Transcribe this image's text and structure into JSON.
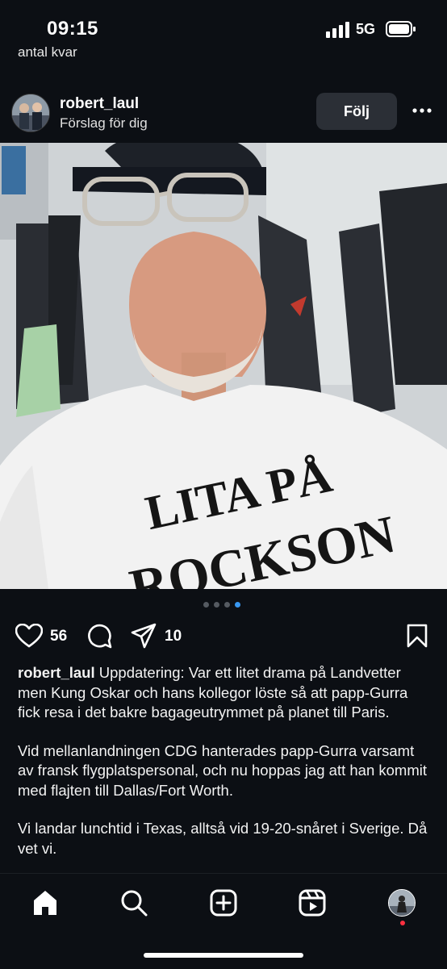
{
  "status": {
    "time": "09:15",
    "network": "5G"
  },
  "prev_caption": "antal kvar",
  "post": {
    "username": "robert_laul",
    "subtitle": "Förslag för dig",
    "follow_label": "Följ",
    "shirt_text_line1": "LITA PÅ",
    "shirt_text_line2": "ROCKSON",
    "carousel": {
      "count": 4,
      "active_index": 3
    },
    "likes": "56",
    "shares": "10",
    "caption_user": "robert_laul",
    "caption_p1": "Uppdatering: Var ett litet drama på Landvetter men Kung Oskar och hans kollegor löste så att papp-Gurra fick resa i det bakre bagageutrymmet på planet till Paris.",
    "caption_p2": "Vid mellanlandningen CDG hanterades papp-Gurra varsamt av fransk flygplatspersonal, och nu hoppas jag att han kommit med flajten till Dallas/Fort Worth.",
    "caption_p3": "Vi landar lunchtid i Texas, alltså vid 19-20-snåret i Sverige. Då vet vi."
  },
  "icons": [
    "signal-icon",
    "battery-icon",
    "more-icon",
    "heart-icon",
    "comment-icon",
    "share-icon",
    "bookmark-icon",
    "home-icon",
    "search-icon",
    "create-icon",
    "reels-icon"
  ],
  "colors": {
    "background": "#0c0f14",
    "active_dot": "#3897f0",
    "follow_button": "#2b2f36",
    "notification": "#ff3040"
  }
}
